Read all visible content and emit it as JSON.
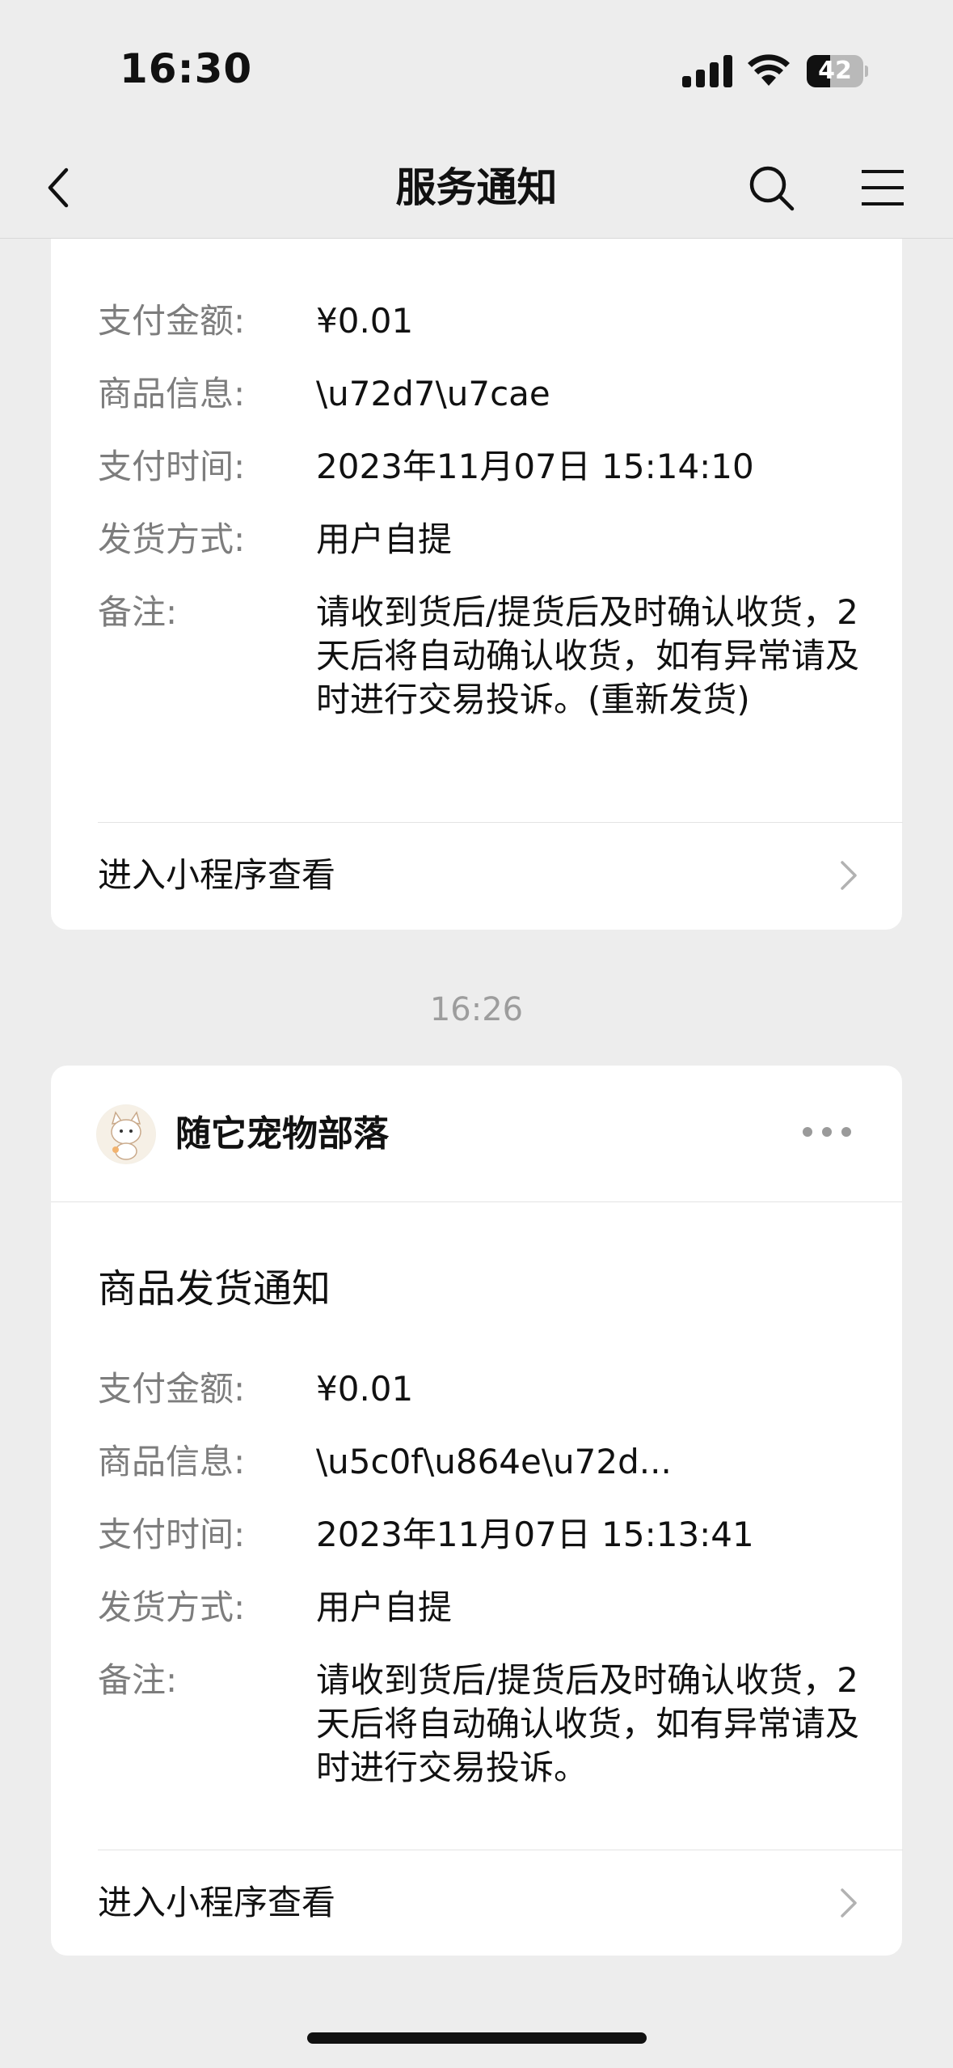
{
  "status_bar": {
    "time": "16:30",
    "battery_level": "42",
    "battery_fraction": 0.42
  },
  "nav": {
    "title": "服务通知",
    "icons": [
      "back-arrow-icon",
      "search-icon",
      "menu-icon"
    ]
  },
  "card1": {
    "rows": [
      {
        "label": "支付金额:",
        "value": "¥0.01"
      },
      {
        "label": "商品信息:",
        "value": "\\u72d7\\u7cae"
      },
      {
        "label": "支付时间:",
        "value": "2023年11月07日 15:14:10"
      },
      {
        "label": "发货方式:",
        "value": "用户自提"
      },
      {
        "label": "备注:",
        "value": "请收到货后/提货后及时确认收货，2天后将自动确认收货，如有异常请及时进行交易投诉。(重新发货)"
      }
    ],
    "link_label": "进入小程序查看"
  },
  "timestamp": "16:26",
  "card2": {
    "store_name": "随它宠物部落",
    "title": "商品发货通知",
    "rows": [
      {
        "label": "支付金额:",
        "value": "¥0.01"
      },
      {
        "label": "商品信息:",
        "value": "\\u5c0f\\u864e\\u72d..."
      },
      {
        "label": "支付时间:",
        "value": "2023年11月07日 15:13:41"
      },
      {
        "label": "发货方式:",
        "value": "用户自提"
      },
      {
        "label": "备注:",
        "value": "请收到货后/提货后及时确认收货，2天后将自动确认收货，如有异常请及时进行交易投诉。"
      }
    ],
    "link_label": "进入小程序查看"
  }
}
